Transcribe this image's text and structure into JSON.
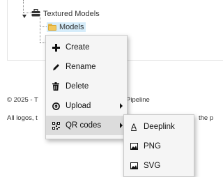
{
  "tree": {
    "parent_label": "Textured Models",
    "child_label": "Models"
  },
  "footer": {
    "line1_left": "© 2025 - T",
    "line1_right": "Pipeline",
    "line2_left": "All logos, t",
    "line2_right": "the p"
  },
  "context_menu": {
    "items": [
      {
        "label": "Create",
        "icon": "plus-icon"
      },
      {
        "label": "Rename",
        "icon": "pencil-icon"
      },
      {
        "label": "Delete",
        "icon": "trash-icon"
      },
      {
        "label": "Upload",
        "icon": "upload-icon",
        "submenu": true
      },
      {
        "label": "QR codes",
        "icon": "qr-code-icon",
        "submenu": true,
        "active": true
      }
    ]
  },
  "submenu": {
    "items": [
      {
        "label": "Deeplink",
        "icon": "underlined-a-icon"
      },
      {
        "label": "PNG",
        "icon": "image-icon"
      },
      {
        "label": "SVG",
        "icon": "image-icon"
      }
    ]
  },
  "colors": {
    "menu_bg": "#f5f5f5",
    "active_item": "#dcdcdc",
    "selected_node": "#d5ecfa"
  }
}
